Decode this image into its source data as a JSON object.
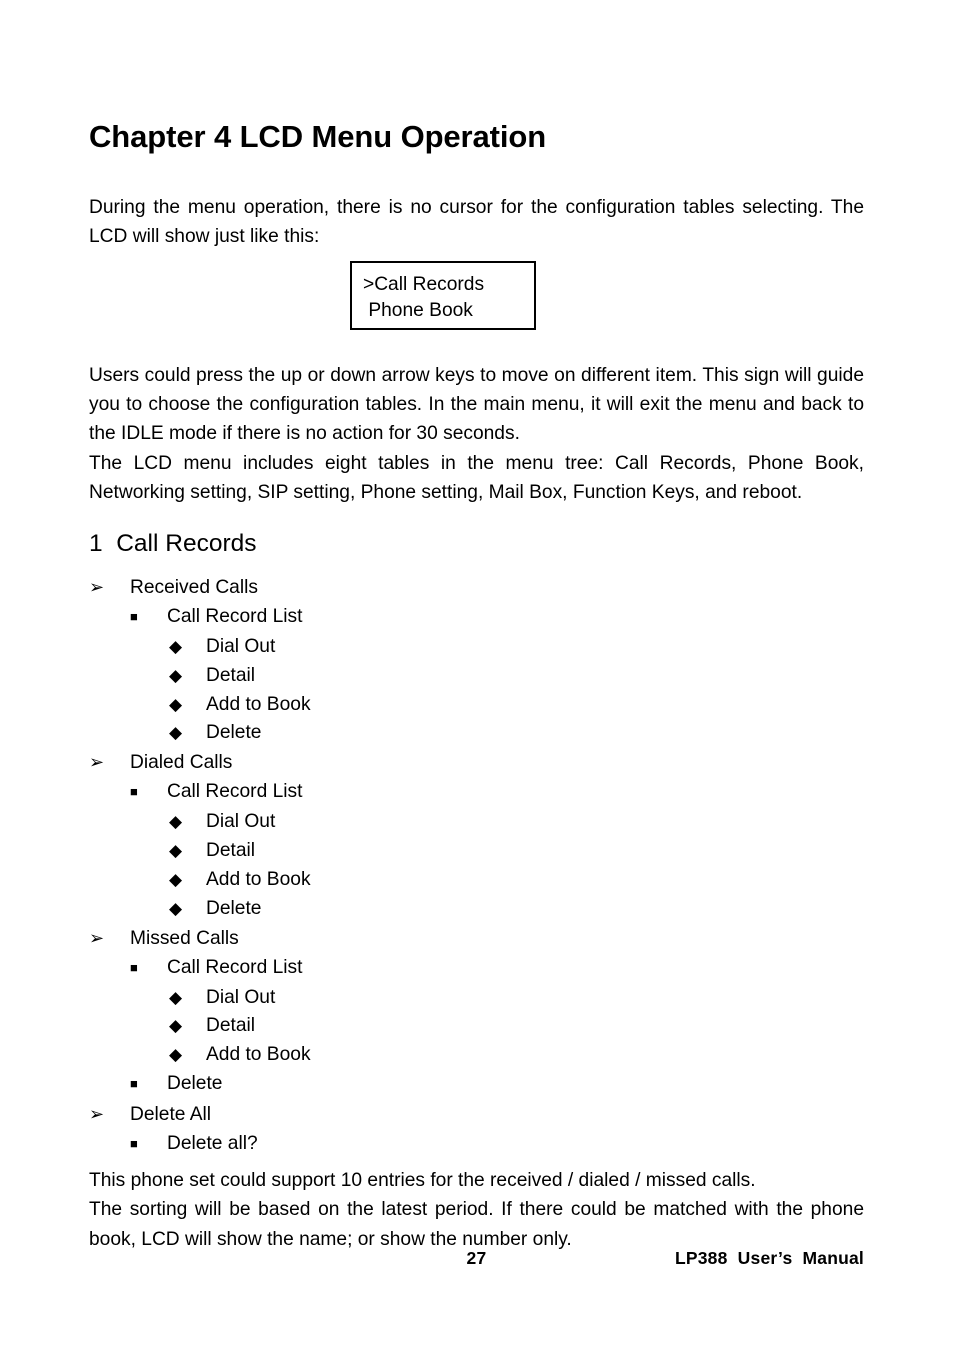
{
  "document": {
    "chapter_title": "Chapter 4 LCD Menu Operation",
    "intro_paragraph": "During the menu operation, there is no cursor for the configuration tables selecting. The LCD will show just like this:",
    "lcd_display": {
      "line1": ">Call Records",
      "line2": " Phone Book"
    },
    "paragraph_after_box": "Users could press the up or down arrow keys to move on different item. This sign will guide you to choose the configuration tables. In the main menu, it will exit the menu and back to the IDLE mode if there is no action for 30 seconds.",
    "paragraph_menu_tree": "The LCD menu includes eight tables in the menu tree: Call Records, Phone Book, Networking setting, SIP setting, Phone setting, Mail Box, Function Keys, and reboot.",
    "section": {
      "number": "1",
      "title": "Call Records",
      "heading_text": "1  Call Records"
    },
    "markers": {
      "level1": "➢",
      "level2": "■",
      "level3": "◆"
    },
    "outline": [
      {
        "level": 1,
        "label": "Received Calls"
      },
      {
        "level": 2,
        "label": "Call Record List"
      },
      {
        "level": 3,
        "label": "Dial Out"
      },
      {
        "level": 3,
        "label": "Detail"
      },
      {
        "level": 3,
        "label": "Add to Book"
      },
      {
        "level": 3,
        "label": "Delete"
      },
      {
        "level": 1,
        "label": "Dialed Calls"
      },
      {
        "level": 2,
        "label": "Call Record List"
      },
      {
        "level": 3,
        "label": "Dial Out"
      },
      {
        "level": 3,
        "label": "Detail"
      },
      {
        "level": 3,
        "label": "Add to Book"
      },
      {
        "level": 3,
        "label": "Delete"
      },
      {
        "level": 1,
        "label": "Missed Calls"
      },
      {
        "level": 2,
        "label": "Call Record List"
      },
      {
        "level": 3,
        "label": "Dial Out"
      },
      {
        "level": 3,
        "label": "Detail"
      },
      {
        "level": 3,
        "label": "Add to Book"
      },
      {
        "level": 2,
        "label": "Delete"
      },
      {
        "level": 1,
        "label": "Delete All"
      },
      {
        "level": 2,
        "label": "Delete all?"
      }
    ],
    "paragraph_entries": "This phone set could support 10 entries for the received / dialed / missed calls.",
    "paragraph_sorting": "The sorting will be based on the latest period. If there could be matched with the phone book, LCD will show the name; or show the number only.",
    "footer": {
      "page_number": "27",
      "manual_name": "LP388  User’s  Manual"
    }
  }
}
